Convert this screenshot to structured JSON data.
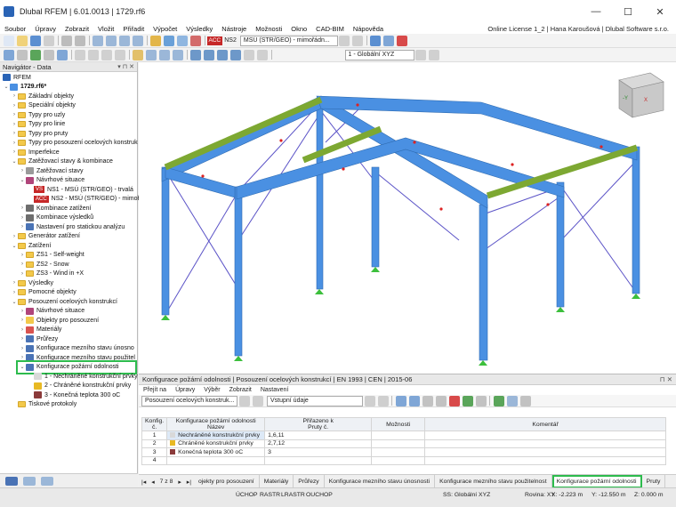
{
  "window": {
    "title": "Dlubal RFEM | 6.01.0013 | 1729.rf6",
    "min": "—",
    "max": "☐",
    "close": "✕"
  },
  "menu": [
    "Soubor",
    "Úpravy",
    "Zobrazit",
    "Vložit",
    "Přiřadit",
    "Výpočet",
    "Výsledky",
    "Nástroje",
    "Možnosti",
    "Okno",
    "CAD-BIM",
    "Nápověda"
  ],
  "license": "Online License 1_2 | Hana Karoušová | Dlubal Software s.r.o.",
  "toolbar": {
    "loadcase_tag": "ACC",
    "loadcase_code": "NS2",
    "loadcase_name": "MSÚ (STR/GEO) - mimořádn...",
    "coord_system": "1 - Globální XYZ"
  },
  "navigator": {
    "title": "Navigátor - Data",
    "root": "RFEM",
    "file": "1729.rf6*",
    "items": [
      "Základní objekty",
      "Speciální objekty",
      "Typy pro uzly",
      "Typy pro linie",
      "Typy pro pruty",
      "Typy pro posouzení ocelových konstruk",
      "Imperfekce",
      "Zatěžovací stavy & kombinace",
      "Zatěžovací stavy",
      "Návrhové situace",
      "NS1 - MSÚ (STR/GEO) - trvalá",
      "NS2 - MSÚ (STR/GEO) - mimoř",
      "Kombinace zatížení",
      "Kombinace výsledků",
      "Nastavení pro statickou analýzu",
      "Generátor zatížení",
      "Zatížení",
      "ZS1 - Self-weight",
      "ZS2 - Snow",
      "ZS3 - Wind in +X",
      "Výsledky",
      "Pomocné objekty",
      "Posouzení ocelových konstrukcí",
      "Návrhové situace",
      "Objekty pro posouzení",
      "Materiály",
      "Průřezy",
      "Konfigurace mezního stavu únosno",
      "Konfigurace mezního stavu použitel",
      "Konfigurace požární odolnosti",
      "1 - Nechráněné konstrukční prvky",
      "2 - Chráněné konstrukční prvky",
      "3 - Konečná teplota 300 oC",
      "Tiskové protokoly"
    ],
    "tags": {
      "ns1": "VS",
      "ns2": "ACC"
    }
  },
  "panel": {
    "title": "Konfigurace požární odolnosti | Posouzení ocelových konstrukcí | EN 1993 | CEN | 2015-06",
    "menu": [
      "Přejít na",
      "Úpravy",
      "Výběr",
      "Zobrazit",
      "Nastavení"
    ],
    "combo_left": "Posouzení ocelových konstruk...",
    "combo_right": "Vstupní údaje",
    "headers": {
      "no1": "Konfig.",
      "no2": "č.",
      "cfg1": "Konfigurace požární odolnosti",
      "cfg2": "Název",
      "assigned1": "Přiřazeno k",
      "assigned2": "Pruty č.",
      "options": "Možnosti",
      "comment": "Komentář"
    },
    "rows": [
      {
        "no": "1",
        "name": "Nechráněné konstrukční prvky",
        "members": "1,6,11",
        "color": "#d9d9d9"
      },
      {
        "no": "2",
        "name": "Chráněné konstrukční prvky",
        "members": "2,7,12",
        "color": "#e8b923"
      },
      {
        "no": "3",
        "name": "Konečná teplota 300 oC",
        "members": "3",
        "color": "#8b3a3a"
      },
      {
        "no": "4",
        "name": "",
        "members": "",
        "color": ""
      }
    ],
    "pager": "7 z 8",
    "tabs": [
      "ojekty pro posouzení",
      "Materiály",
      "Průřezy",
      "Konfigurace mezního stavu únosnosti",
      "Konfigurace mezního stavu použitelnost",
      "Konfigurace požární odolnosti",
      "Pruty"
    ]
  },
  "status": {
    "snap": "ÚCHOP",
    "grid": "RASTR",
    "lgrid": "LRASTR",
    "osnap": "OUCHOP",
    "cs": "SS: Globální XYZ",
    "plane": "Rovina: XY",
    "x": "X: -2.223 m",
    "y": "Y: -12.550 m",
    "z": "Z: 0.000 m"
  },
  "colors": {
    "accent": "#2dbb4d",
    "steel": "#4a90e2",
    "beam_green": "#7da832"
  }
}
